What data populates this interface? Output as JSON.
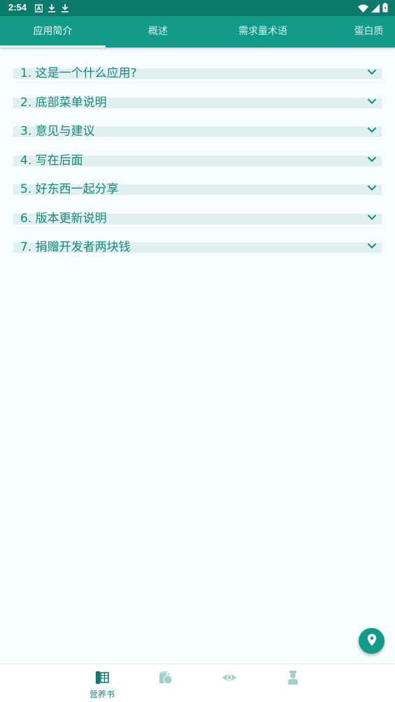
{
  "status_bar": {
    "time": "2:54",
    "icons": [
      "a-icon",
      "download-icon",
      "download-icon",
      "wifi-icon",
      "signal-icon",
      "battery-icon"
    ]
  },
  "tabs": [
    {
      "label": "应用简介",
      "active": true
    },
    {
      "label": "概述",
      "active": false
    },
    {
      "label": "需求量术语",
      "active": false
    },
    {
      "label": "蛋白质",
      "active": false
    }
  ],
  "faq": [
    {
      "label": "1. 这是一个什么应用?"
    },
    {
      "label": "2. 底部菜单说明"
    },
    {
      "label": "3. 意见与建议"
    },
    {
      "label": "4. 写在后面"
    },
    {
      "label": "5. 好东西一起分享"
    },
    {
      "label": "6. 版本更新说明"
    },
    {
      "label": "7. 捐赠开发者两块钱"
    }
  ],
  "fab": {
    "icon": "location-pin-icon"
  },
  "bottom_nav": [
    {
      "label": "营养书",
      "icon": "book-icon",
      "active": true
    },
    {
      "label": "",
      "icon": "food-icon",
      "active": false
    },
    {
      "label": "",
      "icon": "eye-icon",
      "active": false
    },
    {
      "label": "",
      "icon": "doctor-icon",
      "active": false
    }
  ],
  "colors": {
    "primary": "#129b89",
    "status_bar": "#0d7a6e",
    "text_accent": "#15897b",
    "row_highlight": "#dff0ef",
    "background": "#f7fdfd"
  }
}
